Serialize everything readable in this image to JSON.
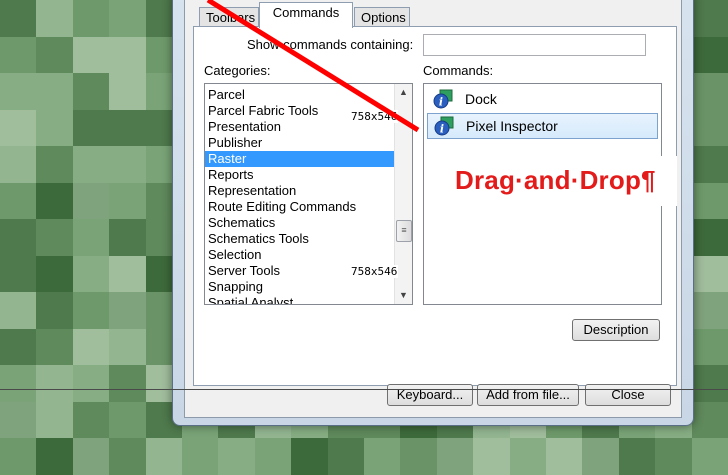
{
  "tabs": [
    {
      "label": "Toolbars"
    },
    {
      "label": "Commands"
    },
    {
      "label": "Options"
    }
  ],
  "search": {
    "label": "Show commands containing:",
    "value": ""
  },
  "categories": {
    "heading": "Categories:",
    "items": [
      {
        "label": "Parcel"
      },
      {
        "label": "Parcel Fabric Tools"
      },
      {
        "label": "Presentation"
      },
      {
        "label": "Publisher"
      },
      {
        "label": "Raster",
        "selected": true
      },
      {
        "label": "Reports"
      },
      {
        "label": "Representation"
      },
      {
        "label": "Route Editing Commands"
      },
      {
        "label": "Schematics"
      },
      {
        "label": "Schematics Tools"
      },
      {
        "label": "Selection"
      },
      {
        "label": "Server Tools"
      },
      {
        "label": "Snapping"
      },
      {
        "label": "Spatial Analyst"
      }
    ]
  },
  "commands": {
    "heading": "Commands:",
    "items": [
      {
        "label": "Dock",
        "icon": "info-icon"
      },
      {
        "label": "Pixel Inspector",
        "icon": "info-icon",
        "selected": true
      }
    ]
  },
  "buttons": {
    "description": "Description",
    "keyboard": "Keyboard...",
    "add_from_file": "Add from file...",
    "close": "Close"
  },
  "overlay": {
    "callout": "Drag·and·Drop¶",
    "dim_label_1": "758x546",
    "dim_label_2": "758x546"
  },
  "colors": {
    "selection": "#3399ff",
    "callout_text": "#e31b1b",
    "arrow_line": "#ff0000"
  }
}
